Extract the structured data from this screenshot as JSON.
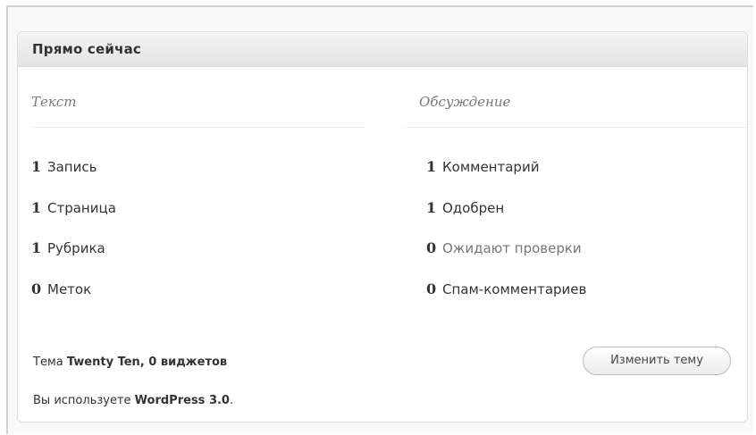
{
  "widget": {
    "title": "Прямо сейчас"
  },
  "content_column": {
    "heading": "Текст",
    "items": [
      {
        "count": "1",
        "label": "Запись"
      },
      {
        "count": "1",
        "label": "Страница"
      },
      {
        "count": "1",
        "label": "Рубрика"
      },
      {
        "count": "0",
        "label": "Меток"
      }
    ]
  },
  "discussion_column": {
    "heading": "Обсуждение",
    "items": [
      {
        "count": "1",
        "label": "Комментарий"
      },
      {
        "count": "1",
        "label": "Одобрен"
      },
      {
        "count": "0",
        "label": "Ожидают проверки"
      },
      {
        "count": "0",
        "label": "Спам-комментариев"
      }
    ]
  },
  "theme_info": {
    "prefix": "Тема ",
    "theme_name": "Twenty Ten",
    "separator": ", ",
    "widgets": "0 виджетов"
  },
  "change_theme_button": "Изменить тему",
  "version_info": {
    "prefix": "Вы используете ",
    "version": "WordPress 3.0",
    "suffix": "."
  },
  "colors": {
    "header_bg": "#e3e3e3",
    "pending_text": "#777777",
    "text": "#333333"
  }
}
